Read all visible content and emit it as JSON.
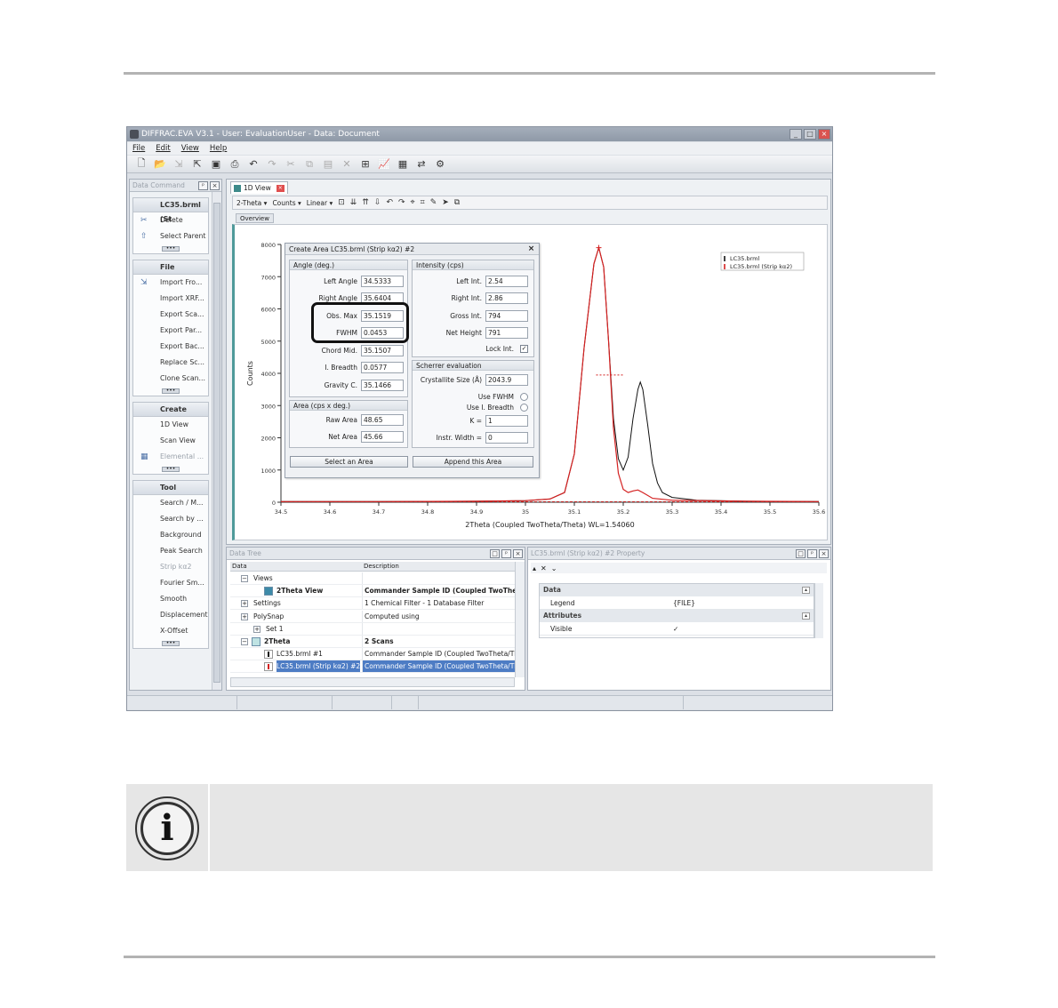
{
  "window": {
    "title": "DIFFRAC.EVA V3.1 - User: EvaluationUser - Data: Document",
    "controls": [
      "_",
      "□",
      "×"
    ]
  },
  "menu": [
    "File",
    "Edit",
    "View",
    "Help"
  ],
  "toolbar_icons": [
    "new-icon",
    "open-icon",
    "import-icon",
    "export-icon",
    "save-icon",
    "print-icon",
    "undo-icon",
    "redo-icon",
    "cut-icon",
    "copy-icon",
    "paste-icon",
    "delete-icon",
    "properties-icon",
    "chart-icon",
    "table-icon",
    "scan-icon",
    "settings-icon"
  ],
  "left_panel": {
    "title": "Data Command",
    "groups": [
      {
        "title": "LC35.brml (St",
        "items": [
          {
            "label": "Delete",
            "enabled": true
          },
          {
            "label": "Select Parent",
            "enabled": true
          }
        ]
      },
      {
        "title": "File",
        "items": [
          {
            "label": "Import Fro...",
            "enabled": true
          },
          {
            "label": "Import XRF...",
            "enabled": true
          },
          {
            "label": "Export Sca...",
            "enabled": true
          },
          {
            "label": "Export Par...",
            "enabled": true
          },
          {
            "label": "Export Bac...",
            "enabled": true
          },
          {
            "label": "Replace Sc...",
            "enabled": true
          },
          {
            "label": "Clone Scan...",
            "enabled": true
          }
        ]
      },
      {
        "title": "Create",
        "items": [
          {
            "label": "1D View",
            "enabled": true
          },
          {
            "label": "Scan View",
            "enabled": true
          },
          {
            "label": "Elemental ...",
            "enabled": false
          }
        ]
      },
      {
        "title": "Tool",
        "items": [
          {
            "label": "Search / M...",
            "enabled": true
          },
          {
            "label": "Search by ...",
            "enabled": true
          },
          {
            "label": "Background",
            "enabled": true
          },
          {
            "label": "Peak Search",
            "enabled": true
          },
          {
            "label": "Strip kα2",
            "enabled": false
          },
          {
            "label": "Fourier Sm...",
            "enabled": true
          },
          {
            "label": "Smooth",
            "enabled": true
          },
          {
            "label": "Displacement",
            "enabled": true
          },
          {
            "label": "X-Offset",
            "enabled": true
          }
        ]
      }
    ]
  },
  "doc_tab": {
    "label": "1D View"
  },
  "chart_toolbar": {
    "xaxis": "2-Theta",
    "yaxis": "Counts",
    "scale": "Linear"
  },
  "overview_label": "Overview",
  "dialog": {
    "title": "Create Area LC35.brml (Strip kα2) #2",
    "angle": {
      "header": "Angle (deg.)",
      "rows": [
        {
          "label": "Left Angle",
          "value": "34.5333"
        },
        {
          "label": "Right Angle",
          "value": "35.6404"
        },
        {
          "label": "Obs. Max",
          "value": "35.1519"
        },
        {
          "label": "FWHM",
          "value": "0.0453"
        },
        {
          "label": "Chord Mid.",
          "value": "35.1507"
        },
        {
          "label": "I. Breadth",
          "value": "0.0577"
        },
        {
          "label": "Gravity C.",
          "value": "35.1466"
        }
      ]
    },
    "area": {
      "header": "Area (cps x deg.)",
      "rows": [
        {
          "label": "Raw Area",
          "value": "48.65"
        },
        {
          "label": "Net Area",
          "value": "45.66"
        }
      ]
    },
    "intensity": {
      "header": "Intensity (cps)",
      "rows": [
        {
          "label": "Left Int.",
          "value": "2.54"
        },
        {
          "label": "Right Int.",
          "value": "2.86"
        },
        {
          "label": "Gross Int.",
          "value": "794"
        },
        {
          "label": "Net Height",
          "value": "791"
        }
      ],
      "lock_label": "Lock Int.",
      "lock_checked": "✓"
    },
    "scherrer": {
      "header": "Scherrer evaluation",
      "crystallite_label": "Crystallite Size (Å)",
      "crystallite_value": "2043.9",
      "use_fwhm": "Use FWHM",
      "use_breadth": "Use I. Breadth",
      "k_label": "K =",
      "k_value": "1",
      "instr_label": "Instr. Width =",
      "instr_value": "0"
    },
    "select_button": "Select an Area",
    "append_button": "Append this Area"
  },
  "chart_data": {
    "type": "line",
    "xlabel": "2Theta (Coupled TwoTheta/Theta) WL=1.54060",
    "ylabel": "Counts",
    "xlim": [
      34.5,
      35.6
    ],
    "ylim": [
      0,
      8000
    ],
    "x_ticks": [
      "34.5",
      "34.6",
      "34.7",
      "34.8",
      "34.9",
      "35",
      "35.1",
      "35.2",
      "35.3",
      "35.4",
      "35.5",
      "35.6"
    ],
    "y_ticks": [
      "0",
      "1000",
      "2000",
      "3000",
      "4000",
      "5000",
      "6000",
      "7000",
      "8000"
    ],
    "legend": [
      "LC35.brml",
      "LC35.brml (Strip kα2)"
    ],
    "legend_position": "top-right",
    "series": [
      {
        "name": "LC35.brml",
        "color": "#111111",
        "x": [
          34.5,
          34.7,
          34.9,
          35.0,
          35.05,
          35.08,
          35.1,
          35.12,
          35.14,
          35.15,
          35.16,
          35.17,
          35.18,
          35.19,
          35.2,
          35.21,
          35.22,
          35.23,
          35.235,
          35.24,
          35.25,
          35.26,
          35.27,
          35.28,
          35.3,
          35.35,
          35.45,
          35.6
        ],
        "y": [
          20,
          20,
          30,
          50,
          100,
          300,
          1500,
          4800,
          7400,
          7900,
          7300,
          5000,
          2600,
          1350,
          1000,
          1400,
          2600,
          3500,
          3730,
          3500,
          2400,
          1200,
          600,
          300,
          150,
          60,
          30,
          20
        ]
      },
      {
        "name": "LC35.brml (Strip kα2)",
        "color": "#d42020",
        "x": [
          34.5,
          34.7,
          34.9,
          35.0,
          35.05,
          35.08,
          35.1,
          35.12,
          35.14,
          35.15,
          35.16,
          35.17,
          35.18,
          35.19,
          35.2,
          35.21,
          35.22,
          35.23,
          35.24,
          35.26,
          35.3,
          35.45,
          35.6
        ],
        "y": [
          20,
          20,
          30,
          50,
          100,
          300,
          1500,
          4800,
          7400,
          7900,
          7300,
          5000,
          2300,
          900,
          400,
          300,
          350,
          380,
          300,
          120,
          60,
          30,
          20
        ]
      }
    ]
  },
  "data_tree": {
    "title": "Data Tree",
    "columns": [
      "Data",
      "Description"
    ],
    "rows": [
      {
        "name": "Views",
        "desc": "",
        "bold": false
      },
      {
        "name": "2Theta View",
        "desc": "Commander Sample ID (Coupled TwoTheta",
        "bold": true
      },
      {
        "name": "Settings",
        "desc": "1 Chemical Filter - 1 Database Filter",
        "bold": false
      },
      {
        "name": "PolySnap",
        "desc": "Computed using",
        "bold": false
      },
      {
        "name": "Set 1",
        "desc": "",
        "bold": false
      },
      {
        "name": "2Theta",
        "desc": "2 Scans",
        "bold": true
      },
      {
        "name": "LC35.brml #1",
        "desc": "Commander Sample ID (Coupled TwoTheta/The",
        "bold": false
      },
      {
        "name": "LC35.brml (Strip kα2) #2",
        "desc": "Commander Sample ID (Coupled TwoTheta/The",
        "bold": false
      }
    ]
  },
  "property_panel": {
    "title": "LC35.brml (Strip kα2) #2 Property",
    "categories": [
      {
        "name": "Data",
        "rows": [
          {
            "key": "Legend",
            "value": "{FILE}"
          }
        ]
      },
      {
        "name": "Attributes",
        "rows": [
          {
            "key": "Visible",
            "value": "✓"
          }
        ]
      }
    ]
  }
}
